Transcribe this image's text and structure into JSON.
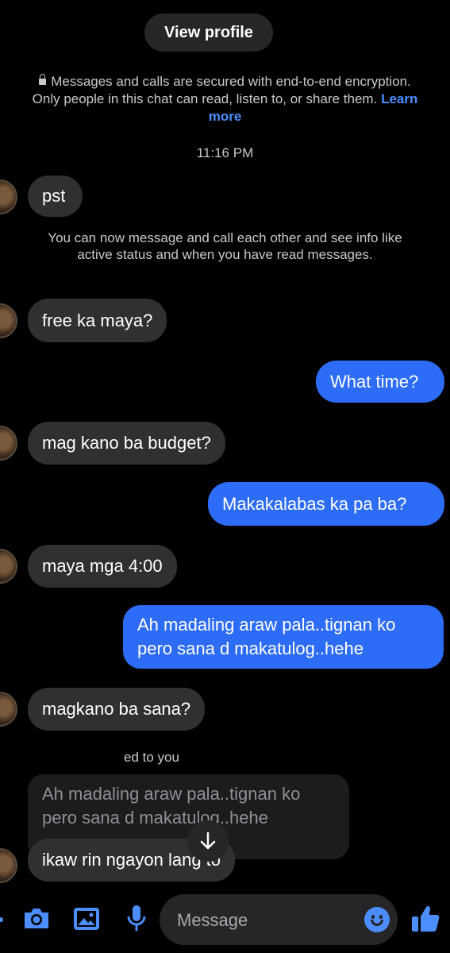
{
  "header": {
    "view_profile_label": "View profile"
  },
  "encryption_notice": {
    "text": "Messages and calls are secured with end-to-end encryption. Only people in this chat can read, listen to, or share them.",
    "link": "Learn more"
  },
  "timestamp": "11:16 PM",
  "info_notice": "You can now message and call each other and see info like active status and when you have read messages.",
  "messages": [
    {
      "side": "in",
      "text": "pst"
    },
    {
      "side": "in",
      "text": "free ka maya?"
    },
    {
      "side": "out",
      "text": "What time?"
    },
    {
      "side": "in",
      "text": "mag kano ba budget?"
    },
    {
      "side": "out",
      "text": "Makakalabas ka pa ba?"
    },
    {
      "side": "in",
      "text": "maya mga 4:00"
    },
    {
      "side": "out",
      "text": "Ah madaling araw pala..tignan ko pero sana d makatulog..hehe"
    },
    {
      "side": "in",
      "text": "magkano ba sana?"
    },
    {
      "side": "in",
      "text": "ikaw rin ngayon lang to"
    }
  ],
  "reply": {
    "label": "ed to you",
    "quoted_text": "Ah madaling araw pala..tignan ko pero sana d makatulog..hehe"
  },
  "composer": {
    "placeholder": "Message"
  },
  "icons": {
    "camera": "camera-icon",
    "gallery": "image-icon",
    "mic": "microphone-icon",
    "emoji": "emoji-icon",
    "like": "thumbs-up-icon",
    "scroll": "arrow-down-icon"
  },
  "colors": {
    "accent": "#2d6cf6",
    "incoming": "#303033",
    "background": "#000000"
  }
}
